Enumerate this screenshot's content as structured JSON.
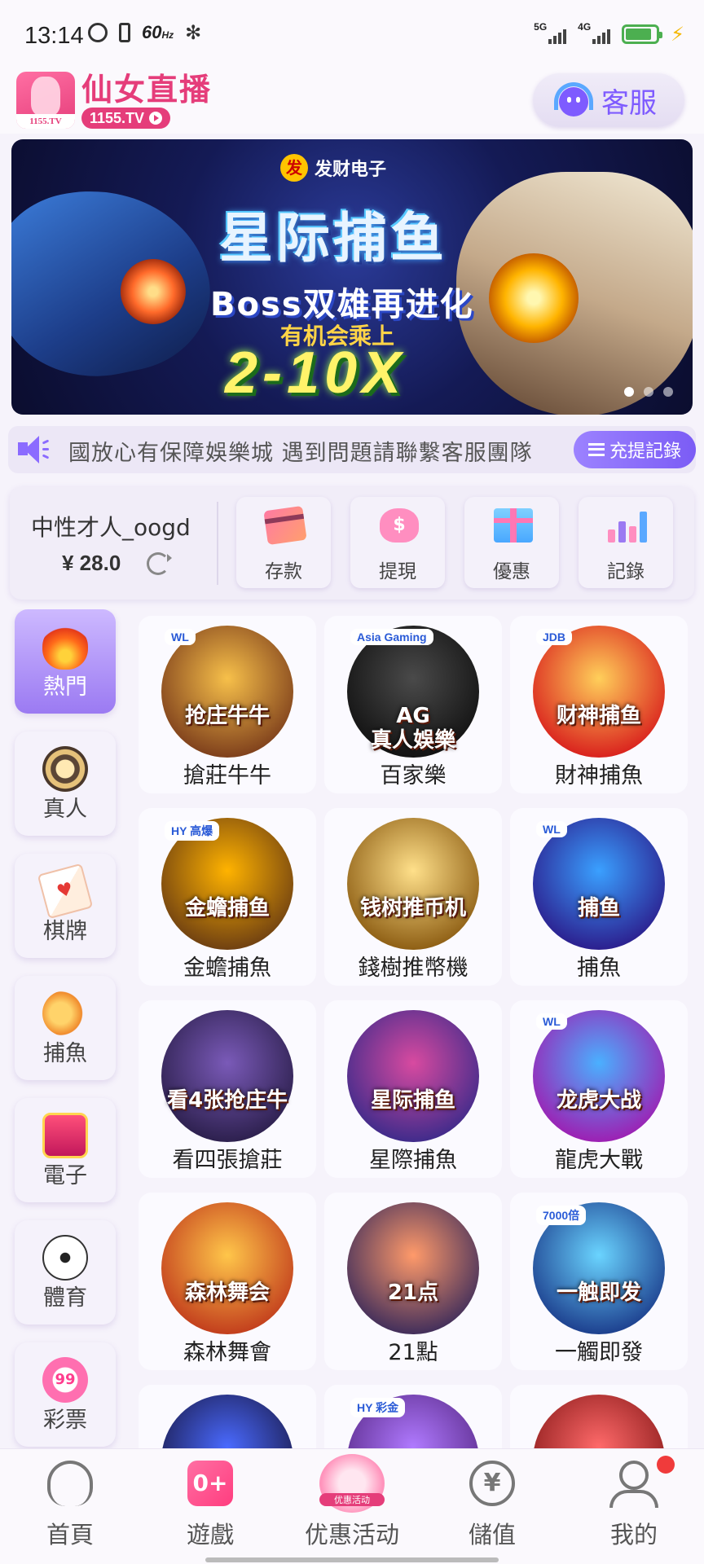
{
  "status_bar": {
    "time": "13:14",
    "refresh_rate": "60",
    "refresh_unit": "Hz",
    "net1": "5G",
    "net2": "4G",
    "battery_level": 0.85
  },
  "header": {
    "logo_title": "仙女直播",
    "logo_badge": "1155.TV",
    "logo_url": "1155.TV",
    "customer_service": "客服"
  },
  "banner": {
    "brand": "发财电子",
    "brand_mark": "发",
    "title": "星际捕鱼",
    "subtitle": "Boss双雄再进化",
    "subtitle2": "有机会乘上",
    "multiplier": "2-10X",
    "dot_count": 3,
    "active_dot": 0
  },
  "marquee": {
    "text": "國放心有保障娛樂城  遇到問題請聯繫客服團隊",
    "record_button": "充提記錄"
  },
  "wallet": {
    "username": "中性才人_oogd",
    "balance": "¥ 28.0",
    "actions": [
      {
        "label": "存款",
        "icon": "card-icon"
      },
      {
        "label": "提現",
        "icon": "money-bag-icon",
        "glyph": "$"
      },
      {
        "label": "優惠",
        "icon": "gift-icon"
      },
      {
        "label": "記錄",
        "icon": "bar-chart-icon"
      }
    ]
  },
  "categories": [
    {
      "label": "熱門",
      "icon": "fire-icon",
      "active": true
    },
    {
      "label": "真人",
      "icon": "chip-icon",
      "active": false
    },
    {
      "label": "棋牌",
      "icon": "cards-icon",
      "active": false,
      "glyph": "♥"
    },
    {
      "label": "捕魚",
      "icon": "fish-icon",
      "active": false
    },
    {
      "label": "電子",
      "icon": "slot-icon",
      "active": false
    },
    {
      "label": "體育",
      "icon": "soccer-ball-icon",
      "active": false
    },
    {
      "label": "彩票",
      "icon": "lottery-ball-icon",
      "active": false,
      "glyph": "99"
    }
  ],
  "games": [
    {
      "name": "搶莊牛牛",
      "art_text": "抢庄牛牛",
      "badge": "WL",
      "colors": [
        "#f7c04a",
        "#7a3b1a"
      ]
    },
    {
      "name": "百家樂",
      "art_text": "AG\n真人娛樂",
      "badge": "Asia Gaming",
      "colors": [
        "#4a4a4a",
        "#111"
      ]
    },
    {
      "name": "財神捕魚",
      "art_text": "财神捕鱼",
      "badge": "JDB",
      "colors": [
        "#ffcf5a",
        "#d81b1b"
      ]
    },
    {
      "name": "金蟾捕魚",
      "art_text": "金蟾捕鱼",
      "badge": "HY 高爆",
      "colors": [
        "#ffb300",
        "#6a3c12"
      ]
    },
    {
      "name": "錢樹推幣機",
      "art_text": "钱树推币机",
      "badge": "",
      "colors": [
        "#ffe08a",
        "#8a5a10"
      ]
    },
    {
      "name": "捕魚",
      "art_text": "捕鱼",
      "badge": "WL",
      "colors": [
        "#3aa0ff",
        "#2b1a8a"
      ]
    },
    {
      "name": "看四張搶莊",
      "art_text": "看4张抢庄牛",
      "badge": "",
      "colors": [
        "#7a5ab8",
        "#2a1e4a"
      ]
    },
    {
      "name": "星際捕魚",
      "art_text": "星际捕鱼",
      "badge": "",
      "colors": [
        "#d84aa0",
        "#3a2a8a"
      ]
    },
    {
      "name": "龍虎大戰",
      "art_text": "龙虎大战",
      "badge": "WL",
      "colors": [
        "#4ab0ff",
        "#a01ab0"
      ]
    },
    {
      "name": "森林舞會",
      "art_text": "森林舞会",
      "badge": "",
      "colors": [
        "#ffc64a",
        "#c0391b"
      ]
    },
    {
      "name": "21點",
      "art_text": "21点",
      "badge": "",
      "colors": [
        "#ff9a6a",
        "#3a2a5a"
      ]
    },
    {
      "name": "一觸即發",
      "art_text": "一触即发",
      "badge": "7000倍",
      "colors": [
        "#6ad4ff",
        "#1a3a8a"
      ]
    },
    {
      "name": "",
      "art_text": "",
      "badge": "",
      "colors": [
        "#4a6aff",
        "#1a1a4a"
      ]
    },
    {
      "name": "",
      "art_text": "",
      "badge": "HY 彩金",
      "colors": [
        "#b07aff",
        "#5a2a8a"
      ]
    },
    {
      "name": "",
      "art_text": "",
      "badge": "",
      "colors": [
        "#ff6a6a",
        "#8a1a1a"
      ]
    }
  ],
  "bottom_nav": [
    {
      "label": "首頁",
      "icon": "home-avatar-icon"
    },
    {
      "label": "遊戲",
      "icon": "gamepad-icon",
      "glyph": "0+"
    },
    {
      "label": "优惠活动",
      "icon": "promo-badge-icon",
      "badge_text": "优惠活动"
    },
    {
      "label": "儲值",
      "icon": "yen-icon",
      "glyph": "¥"
    },
    {
      "label": "我的",
      "icon": "profile-icon",
      "has_notification": true
    }
  ]
}
